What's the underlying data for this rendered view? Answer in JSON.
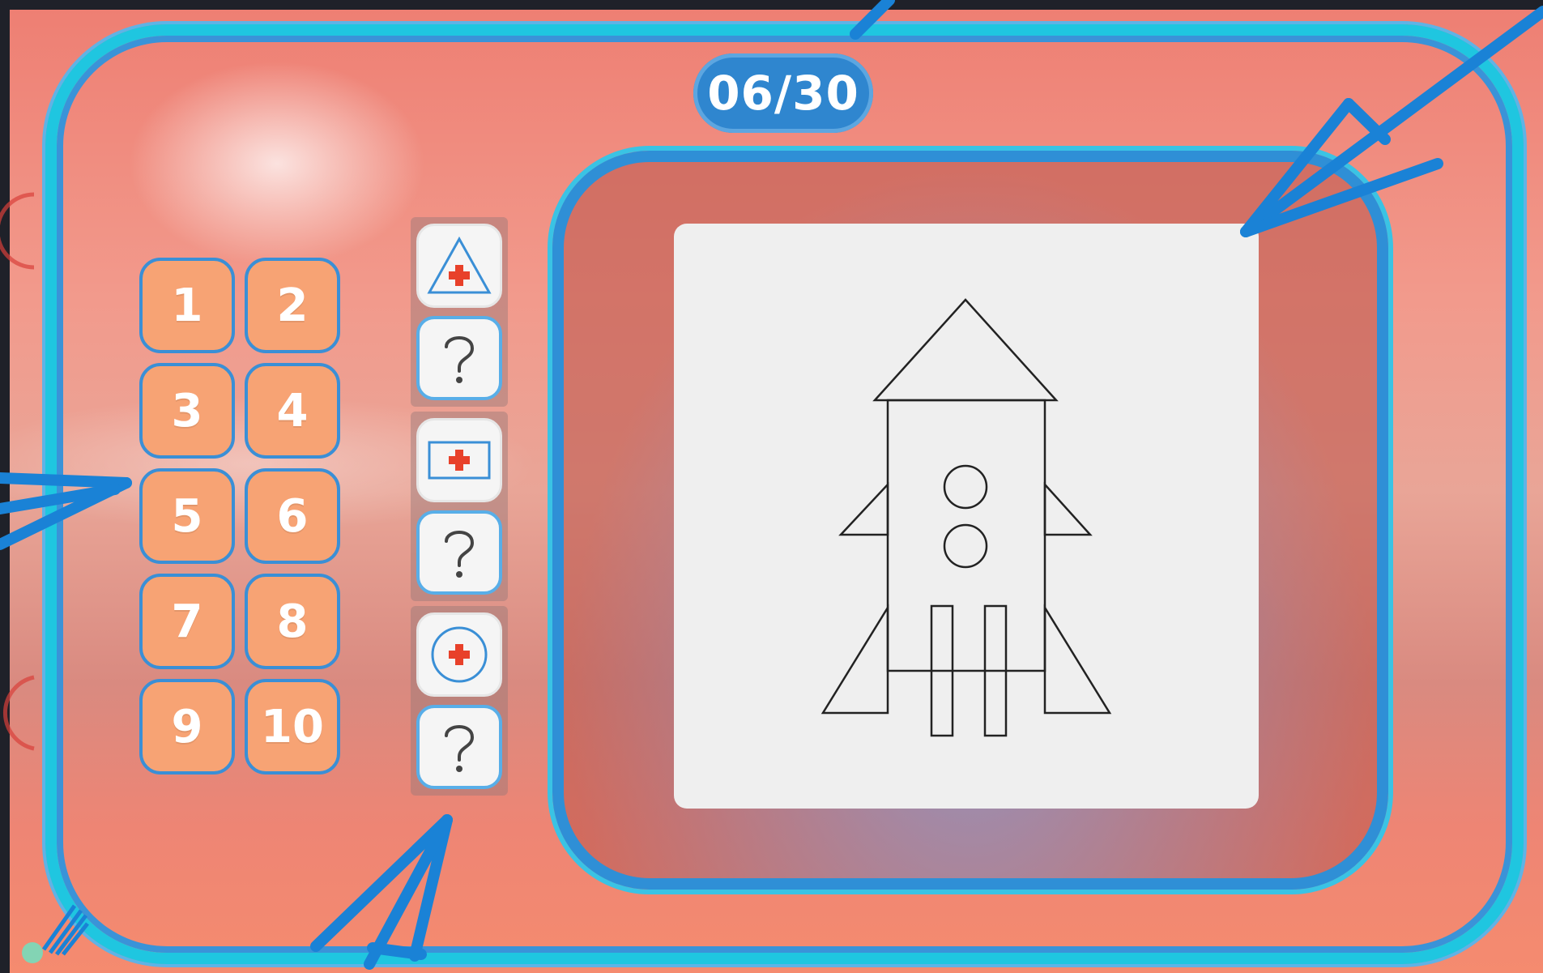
{
  "header": {
    "counter": "06/30"
  },
  "number_pad": {
    "buttons": [
      "1",
      "2",
      "3",
      "4",
      "5",
      "6",
      "7",
      "8",
      "9",
      "10"
    ]
  },
  "shape_column": {
    "groups": [
      {
        "shape": "triangle-plus-icon",
        "query": "question-mark-icon"
      },
      {
        "shape": "rectangle-plus-icon",
        "query": "question-mark-icon"
      },
      {
        "shape": "circle-plus-icon",
        "query": "question-mark-icon"
      }
    ]
  },
  "drawing": {
    "subject": "rocket-icon"
  },
  "colors": {
    "frame_cyan": "#1fc6e0",
    "frame_blue": "#2f8fd6",
    "button_orange": "#f7a374",
    "plus_red": "#e8412a",
    "annotation_blue": "#1a82d6"
  }
}
